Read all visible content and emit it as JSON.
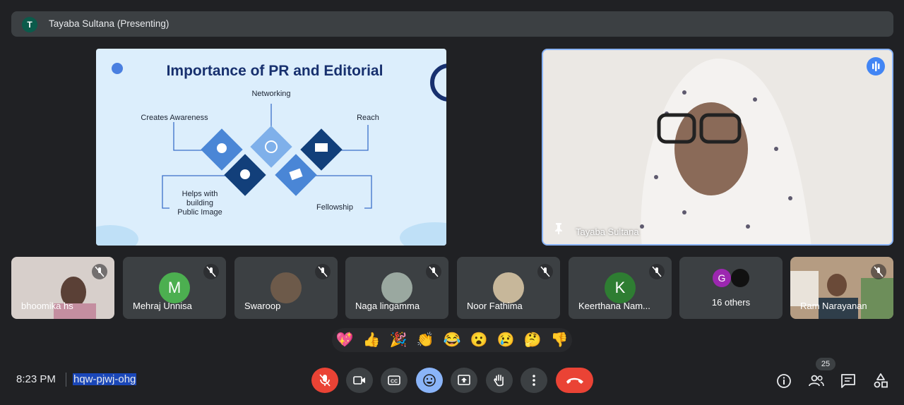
{
  "header": {
    "avatar_letter": "T",
    "presenter_label": "Tayaba Sultana (Presenting)"
  },
  "slide": {
    "title": "Importance of PR and Editorial",
    "labels": {
      "networking": "Networking",
      "awareness": "Creates Awareness",
      "reach": "Reach",
      "image": "Helps with building Public Image",
      "fellowship": "Fellowship"
    }
  },
  "presenter": {
    "name": "Tayaba Sultana"
  },
  "participants": [
    {
      "name": "bhoomika hs",
      "muted": true
    },
    {
      "name": "Mehraj Unnisa",
      "avatar_letter": "M",
      "avatar_color": "#4caf50",
      "muted": true
    },
    {
      "name": "Swaroop",
      "muted": true
    },
    {
      "name": "Naga lingamma",
      "muted": true
    },
    {
      "name": "Noor Fathima",
      "muted": true
    },
    {
      "name": "Keerthana Nam...",
      "avatar_letter": "K",
      "avatar_color": "#2e7d32",
      "muted": true
    },
    {
      "name": "16 others",
      "avatar_letter": "G",
      "avatar_color": "#9c27b0"
    },
    {
      "name": "Ram Narayanan",
      "muted": true
    }
  ],
  "reactions": [
    "💖",
    "👍",
    "🎉",
    "👏",
    "😂",
    "😮",
    "😢",
    "🤔",
    "👎"
  ],
  "bottom": {
    "time": "8:23 PM",
    "meeting_code": "hqw-pjwj-ohg",
    "participant_count": "25"
  },
  "colors": {
    "end_call": "#ea4335",
    "accent": "#8ab4f8",
    "tile": "#3c4043"
  }
}
